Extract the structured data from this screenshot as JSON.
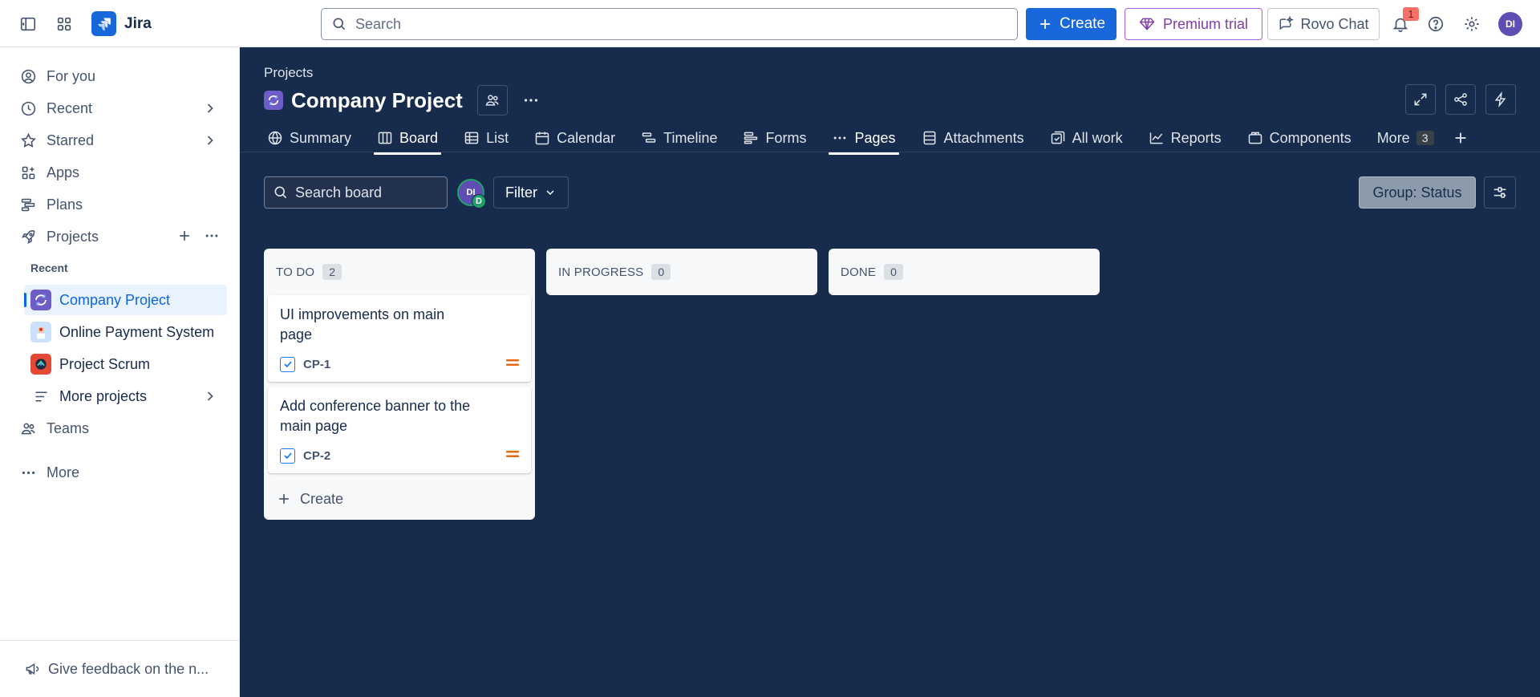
{
  "topbar": {
    "app_name": "Jira",
    "search_placeholder": "Search",
    "create_label": "Create",
    "premium_label": "Premium trial",
    "rovo_label": "Rovo Chat",
    "notification_count": "1",
    "avatar_initials": "DI",
    "colors": {
      "primary": "#1868db",
      "premium": "#803fa5"
    }
  },
  "sidebar": {
    "items": [
      {
        "label": "For you",
        "icon": "user-circle-icon"
      },
      {
        "label": "Recent",
        "icon": "clock-icon"
      },
      {
        "label": "Starred",
        "icon": "star-icon"
      },
      {
        "label": "Apps",
        "icon": "apps-icon"
      },
      {
        "label": "Plans",
        "icon": "plans-icon"
      },
      {
        "label": "Projects",
        "icon": "rocket-icon"
      }
    ],
    "recent_label": "Recent",
    "projects": [
      {
        "label": "Company Project",
        "active": true
      },
      {
        "label": "Online Payment System",
        "active": false
      },
      {
        "label": "Project Scrum",
        "active": false
      }
    ],
    "more_projects_label": "More projects",
    "teams_label": "Teams",
    "more_label": "More",
    "feedback_label": "Give feedback on the n..."
  },
  "main": {
    "breadcrumb": "Projects",
    "title": "Company Project",
    "tabs": [
      {
        "label": "Summary",
        "icon": "globe-icon"
      },
      {
        "label": "Board",
        "icon": "board-icon",
        "active": true
      },
      {
        "label": "List",
        "icon": "list-icon"
      },
      {
        "label": "Calendar",
        "icon": "calendar-icon"
      },
      {
        "label": "Timeline",
        "icon": "timeline-icon"
      },
      {
        "label": "Forms",
        "icon": "forms-icon"
      },
      {
        "label": "Pages",
        "icon": "more-dots-icon",
        "active": true
      },
      {
        "label": "Attachments",
        "icon": "attachment-icon"
      },
      {
        "label": "All work",
        "icon": "all-work-icon"
      },
      {
        "label": "Reports",
        "icon": "chart-icon"
      },
      {
        "label": "Components",
        "icon": "component-icon"
      }
    ],
    "more_tab_label": "More",
    "more_tab_count": "3",
    "board_search_placeholder": "Search board",
    "avatar_initials": "DI",
    "avatar_secondary": "D",
    "filter_label": "Filter",
    "group_label": "Group: Status",
    "colors": {
      "background": "#172b4d",
      "column": "#f7f8f9"
    }
  },
  "columns": [
    {
      "name": "TO DO",
      "count": "2",
      "cards": [
        {
          "title": "UI improvements on main page",
          "key": "CP-1",
          "priority": "medium"
        },
        {
          "title": "Add conference banner to the main page",
          "key": "CP-2",
          "priority": "medium"
        }
      ],
      "create_label": "Create"
    },
    {
      "name": "IN PROGRESS",
      "count": "0",
      "cards": []
    },
    {
      "name": "DONE",
      "count": "0",
      "cards": []
    }
  ]
}
